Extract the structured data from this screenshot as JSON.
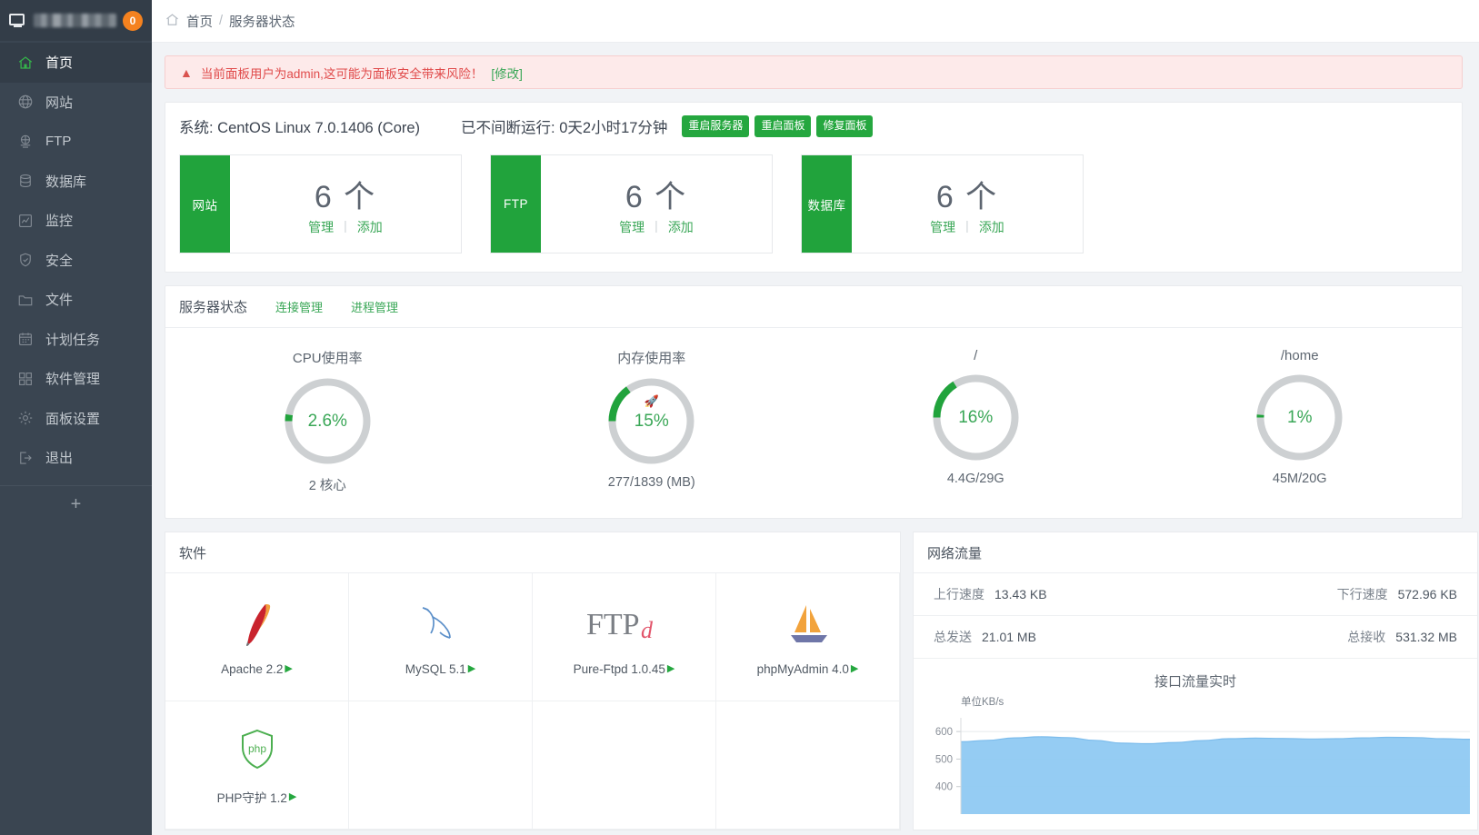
{
  "sidebar": {
    "brand": {
      "badge": "0",
      "title_redacted": true
    },
    "items": [
      {
        "label": "首页",
        "icon": "home-icon",
        "active": true
      },
      {
        "label": "网站",
        "icon": "globe-icon",
        "active": false
      },
      {
        "label": "FTP",
        "icon": "ftp-icon",
        "active": false
      },
      {
        "label": "数据库",
        "icon": "database-icon",
        "active": false
      },
      {
        "label": "监控",
        "icon": "monitor-icon",
        "active": false
      },
      {
        "label": "安全",
        "icon": "shield-icon",
        "active": false
      },
      {
        "label": "文件",
        "icon": "folder-icon",
        "active": false
      },
      {
        "label": "计划任务",
        "icon": "calendar-icon",
        "active": false
      },
      {
        "label": "软件管理",
        "icon": "apps-icon",
        "active": false
      },
      {
        "label": "面板设置",
        "icon": "gear-icon",
        "active": false
      },
      {
        "label": "退出",
        "icon": "logout-icon",
        "active": false
      }
    ],
    "add_label": "+"
  },
  "breadcrumb": {
    "home": "首页",
    "separator": "/",
    "current": "服务器状态"
  },
  "alert": {
    "icon": "warning-icon",
    "text": "当前面板用户为admin,这可能为面板安全带来风险！",
    "action": "[修改]"
  },
  "system": {
    "os_label": "系统: CentOS Linux 7.0.1406 (Core)",
    "uptime_label": "已不间断运行: 0天2小时17分钟",
    "buttons": [
      "重启服务器",
      "重启面板",
      "修复面板"
    ]
  },
  "cards": [
    {
      "tag": "网站",
      "count": "6 个",
      "manage": "管理",
      "divider": "|",
      "add": "添加"
    },
    {
      "tag": "FTP",
      "count": "6 个",
      "manage": "管理",
      "divider": "|",
      "add": "添加"
    },
    {
      "tag": "数据库",
      "count": "6 个",
      "manage": "管理",
      "divider": "|",
      "add": "添加"
    }
  ],
  "server_status": {
    "title": "服务器状态",
    "links": [
      "连接管理",
      "进程管理"
    ],
    "gauges": [
      {
        "title": "CPU使用率",
        "value": "2.6%",
        "percent": 2.6,
        "sub": "2 核心",
        "rocket": false
      },
      {
        "title": "内存使用率",
        "value": "15%",
        "percent": 15,
        "sub": "277/1839 (MB)",
        "rocket": true
      },
      {
        "title": "/",
        "value": "16%",
        "percent": 16,
        "sub": "4.4G/29G",
        "rocket": false
      },
      {
        "title": "/home",
        "value": "1%",
        "percent": 1,
        "sub": "45M/20G",
        "rocket": false
      }
    ]
  },
  "software": {
    "title": "软件",
    "items": [
      {
        "name": "Apache 2.2",
        "icon": "apache-feather-icon"
      },
      {
        "name": "MySQL 5.1",
        "icon": "mysql-dolphin-icon"
      },
      {
        "name": "Pure-Ftpd 1.0.45",
        "icon": "pureftpd-icon"
      },
      {
        "name": "phpMyAdmin 4.0",
        "icon": "phpmyadmin-sailboat-icon"
      },
      {
        "name": "PHP守护 1.2",
        "icon": "php-shield-icon"
      }
    ]
  },
  "network": {
    "title": "网络流量",
    "rows": [
      {
        "left_label": "上行速度",
        "left_value": "13.43 KB",
        "right_label": "下行速度",
        "right_value": "572.96 KB"
      },
      {
        "left_label": "总发送",
        "left_value": "21.01 MB",
        "right_label": "总接收",
        "right_value": "531.32 MB"
      }
    ]
  },
  "chart_data": {
    "type": "area",
    "title": "接口流量实时",
    "unit_label": "单位KB/s",
    "ylabel": "KB/s",
    "xlabel": "",
    "ytick_labels": [
      "600",
      "500",
      "400"
    ],
    "yticks": [
      600,
      500,
      400
    ],
    "ylim": [
      300,
      650
    ],
    "grid": true,
    "legend": false,
    "series": [
      {
        "name": "接口流量",
        "color": "#8fc9f2",
        "values": [
          563,
          568,
          577,
          581,
          578,
          568,
          558,
          556,
          560,
          567,
          574,
          576,
          575,
          573,
          574,
          577,
          579,
          578,
          574,
          572
        ]
      }
    ]
  },
  "colors": {
    "accent_green": "#25a73f",
    "link_green": "#3aa757",
    "alert_red": "#e04b4b",
    "badge_orange": "#f5821f",
    "sidebar_bg": "#3a4551",
    "chart_blue": "#8fc9f2"
  }
}
